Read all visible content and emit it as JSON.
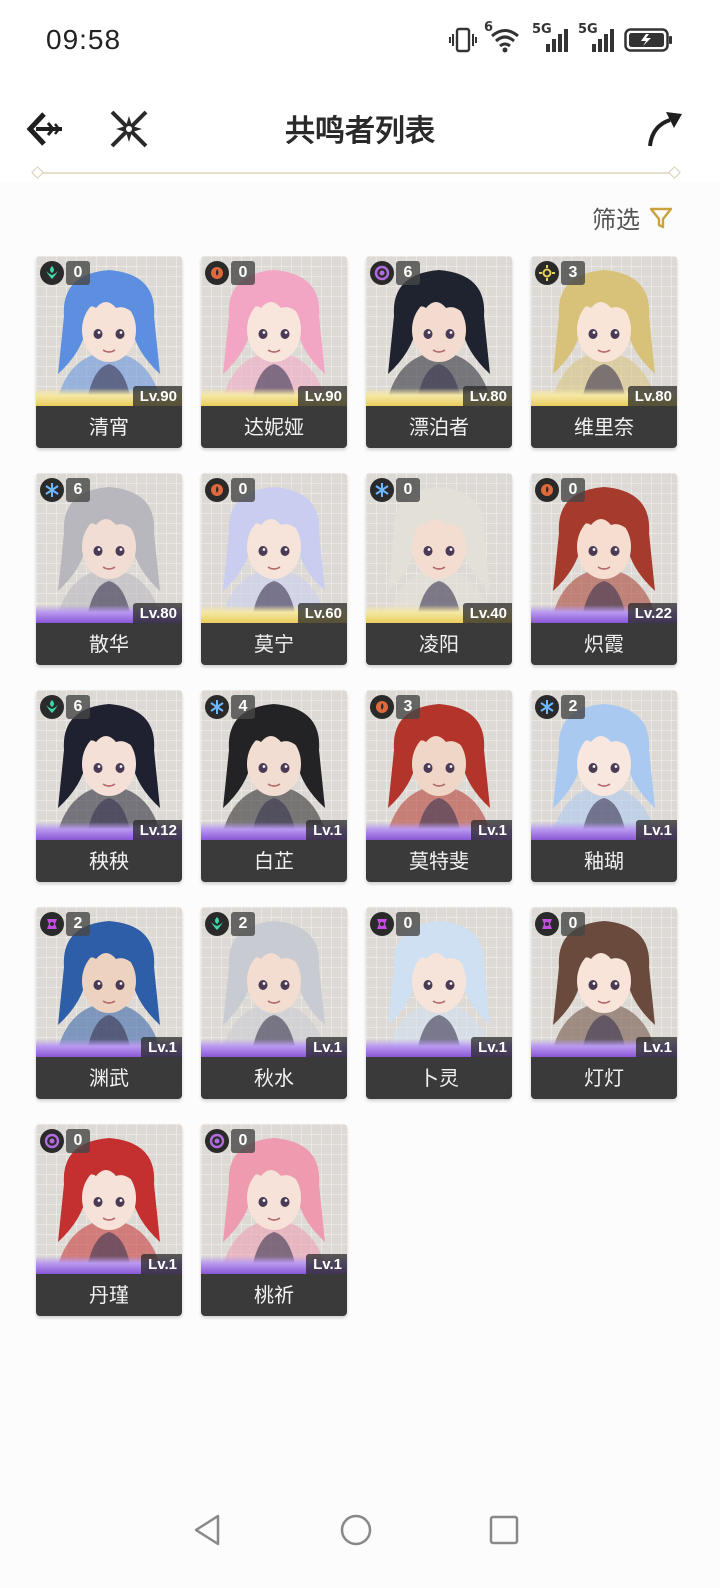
{
  "status": {
    "time": "09:58",
    "sig1": "5G",
    "sig2": "5G",
    "wifi_badge": "6"
  },
  "header": {
    "title": "共鸣者列表"
  },
  "filter": {
    "label": "筛选"
  },
  "colors": {
    "havoc": "#b26ce0",
    "fusion": "#e06a3c",
    "glacio": "#6fb8ff",
    "aero": "#3fd6a8",
    "spectro": "#e8d25e",
    "electro": "#c34ee0"
  },
  "characters": [
    {
      "name": "清宵",
      "level": "Lv.90",
      "sequence": "0",
      "element": "aero",
      "rarity": 5,
      "hair": "#5d8fe0",
      "skin": "#f6e2d6"
    },
    {
      "name": "达妮娅",
      "level": "Lv.90",
      "sequence": "0",
      "element": "fusion",
      "rarity": 5,
      "hair": "#f2a6c4",
      "skin": "#f8e6dd"
    },
    {
      "name": "漂泊者",
      "level": "Lv.80",
      "sequence": "6",
      "element": "havoc",
      "rarity": 5,
      "hair": "#1f2330",
      "skin": "#f3dccf"
    },
    {
      "name": "维里奈",
      "level": "Lv.80",
      "sequence": "3",
      "element": "spectro",
      "rarity": 5,
      "hair": "#d8c27a",
      "skin": "#f8e5d7"
    },
    {
      "name": "散华",
      "level": "Lv.80",
      "sequence": "6",
      "element": "glacio",
      "rarity": 4,
      "hair": "#b7b7bd",
      "skin": "#f1ddd3"
    },
    {
      "name": "莫宁",
      "level": "Lv.60",
      "sequence": "0",
      "element": "fusion",
      "rarity": 5,
      "hair": "#c9cdf0",
      "skin": "#f6e3da"
    },
    {
      "name": "凌阳",
      "level": "Lv.40",
      "sequence": "0",
      "element": "glacio",
      "rarity": 5,
      "hair": "#e3e0d8",
      "skin": "#f2ddd0"
    },
    {
      "name": "炽霞",
      "level": "Lv.22",
      "sequence": "0",
      "element": "fusion",
      "rarity": 4,
      "hair": "#a63a2c",
      "skin": "#f5ddcf"
    },
    {
      "name": "秧秧",
      "level": "Lv.12",
      "sequence": "6",
      "element": "aero",
      "rarity": 4,
      "hair": "#1f2030",
      "skin": "#f4e0d6"
    },
    {
      "name": "白芷",
      "level": "Lv.1",
      "sequence": "4",
      "element": "glacio",
      "rarity": 4,
      "hair": "#232325",
      "skin": "#f2ddd2"
    },
    {
      "name": "莫特斐",
      "level": "Lv.1",
      "sequence": "3",
      "element": "fusion",
      "rarity": 4,
      "hair": "#b2342a",
      "skin": "#f0d6c6"
    },
    {
      "name": "釉瑚",
      "level": "Lv.1",
      "sequence": "2",
      "element": "glacio",
      "rarity": 4,
      "hair": "#a9c9f0",
      "skin": "#f8e7df"
    },
    {
      "name": "渊武",
      "level": "Lv.1",
      "sequence": "2",
      "element": "electro",
      "rarity": 4,
      "hair": "#2f5ea8",
      "skin": "#ecd2bf"
    },
    {
      "name": "秋水",
      "level": "Lv.1",
      "sequence": "2",
      "element": "aero",
      "rarity": 4,
      "hair": "#c9cbd2",
      "skin": "#f2ddd0"
    },
    {
      "name": "卜灵",
      "level": "Lv.1",
      "sequence": "0",
      "element": "electro",
      "rarity": 4,
      "hair": "#cfe0f2",
      "skin": "#f6e4da"
    },
    {
      "name": "灯灯",
      "level": "Lv.1",
      "sequence": "0",
      "element": "electro",
      "rarity": 4,
      "hair": "#6a4a3c",
      "skin": "#f8e4d8"
    },
    {
      "name": "丹瑾",
      "level": "Lv.1",
      "sequence": "0",
      "element": "havoc",
      "rarity": 4,
      "hair": "#c42f2f",
      "skin": "#f6e2d8"
    },
    {
      "name": "桃祈",
      "level": "Lv.1",
      "sequence": "0",
      "element": "havoc",
      "rarity": 4,
      "hair": "#ee9bb0",
      "skin": "#f6e2d8"
    }
  ]
}
